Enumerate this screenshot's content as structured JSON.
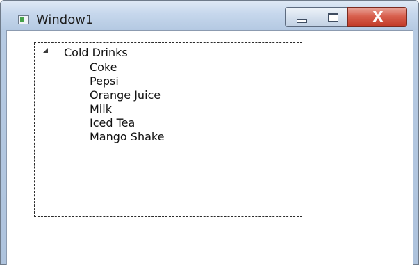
{
  "window": {
    "title": "Window1"
  },
  "caption_buttons": {
    "minimize_icon": "minimize-icon",
    "maximize_icon": "maximize-icon",
    "close_icon": "close-icon",
    "close_glyph": "X"
  },
  "tree": {
    "root_label": "Cold Drinks",
    "expanded": true,
    "items": [
      "Coke",
      "Pepsi",
      "Orange Juice",
      "Milk",
      "Iced Tea",
      "Mango Shake"
    ]
  },
  "colors": {
    "close_button": "#c13a27",
    "titlebar": "#c6d7ec"
  }
}
